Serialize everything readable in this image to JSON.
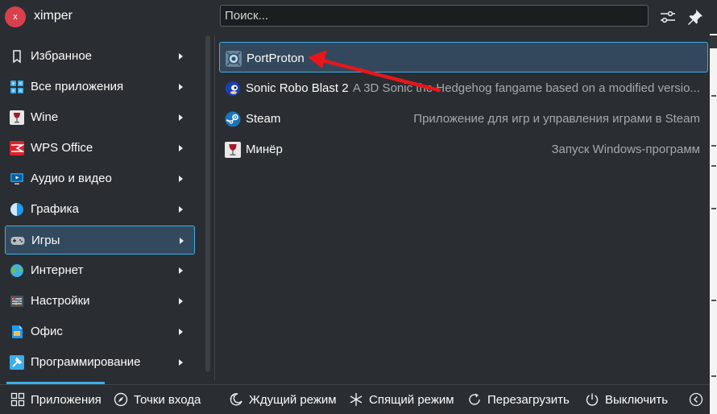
{
  "user": {
    "avatar_initial": "x",
    "name": "ximper"
  },
  "search": {
    "placeholder": "Поиск..."
  },
  "header_icons": [
    "settings-sliders-icon",
    "pin-icon"
  ],
  "categories": [
    {
      "label": "Избранное",
      "icon": "bookmark-icon"
    },
    {
      "label": "Все приложения",
      "icon": "grid-icon"
    },
    {
      "label": "Wine",
      "icon": "wine-glass-icon"
    },
    {
      "label": "WPS Office",
      "icon": "wps-office-icon"
    },
    {
      "label": "Аудио и видео",
      "icon": "monitor-icon"
    },
    {
      "label": "Графика",
      "icon": "graphics-icon"
    },
    {
      "label": "Игры",
      "icon": "gamepad-icon",
      "active": true
    },
    {
      "label": "Интернет",
      "icon": "globe-icon"
    },
    {
      "label": "Настройки",
      "icon": "settings-icon"
    },
    {
      "label": "Офис",
      "icon": "office-icon"
    },
    {
      "label": "Программирование",
      "icon": "hammer-icon"
    }
  ],
  "apps": [
    {
      "name": "PortProton",
      "description": "",
      "icon": "portproton-icon",
      "active": true
    },
    {
      "name": "Sonic Robo Blast 2",
      "description": "A 3D Sonic the Hedgehog fangame based on a modified versio...",
      "icon": "sonic-icon"
    },
    {
      "name": "Steam",
      "description": "Приложение для игр и управления играми в Steam",
      "icon": "steam-icon"
    },
    {
      "name": "Минёр",
      "description": "Запуск Windows-программ",
      "icon": "wine-glass-icon"
    }
  ],
  "bottom_bar": {
    "applications": "Приложения",
    "entry_points": "Точки входа",
    "standby": "Ждущий режим",
    "sleep": "Спящий режим",
    "restart": "Перезагрузить",
    "shutdown": "Выключить"
  },
  "colors": {
    "accent": "#3daee9",
    "background": "#2a2e32",
    "annotation_arrow": "#e8161b"
  }
}
